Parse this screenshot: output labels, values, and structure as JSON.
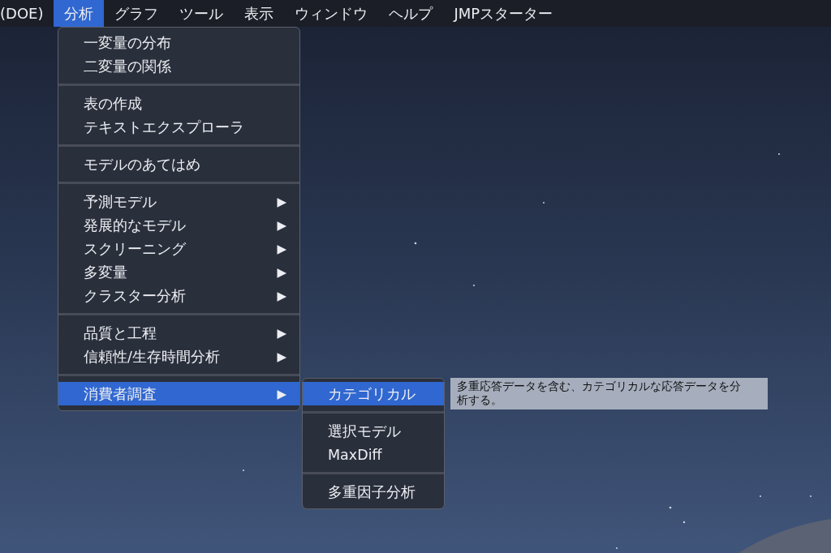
{
  "menu_bar": {
    "items": [
      {
        "label": "(DOE)",
        "selected": false
      },
      {
        "label": "分析",
        "selected": true
      },
      {
        "label": "グラフ",
        "selected": false
      },
      {
        "label": "ツール",
        "selected": false
      },
      {
        "label": "表示",
        "selected": false
      },
      {
        "label": "ウィンドウ",
        "selected": false
      },
      {
        "label": "ヘルプ",
        "selected": false
      },
      {
        "label": "JMPスターター",
        "selected": false
      }
    ]
  },
  "analysis_menu": {
    "groups": [
      [
        {
          "label": "一変量の分布",
          "selected": false
        },
        {
          "label": "二変量の関係",
          "selected": false
        }
      ],
      [
        {
          "label": "表の作成",
          "selected": false
        },
        {
          "label": "テキストエクスプローラ",
          "selected": false
        }
      ],
      [
        {
          "label": "モデルのあてはめ",
          "selected": false
        }
      ],
      [
        {
          "label": "予測モデル",
          "arrow": "▶",
          "selected": false
        },
        {
          "label": "発展的なモデル",
          "arrow": "▶",
          "selected": false
        },
        {
          "label": "スクリーニング",
          "arrow": "▶",
          "selected": false
        },
        {
          "label": "多変量",
          "arrow": "▶",
          "selected": false
        },
        {
          "label": "クラスター分析",
          "arrow": "▶",
          "selected": false
        }
      ],
      [
        {
          "label": "品質と工程",
          "arrow": "▶",
          "selected": false
        },
        {
          "label": "信頼性/生存時間分析",
          "arrow": "▶",
          "selected": false
        }
      ],
      [
        {
          "label": "消費者調査",
          "arrow": "▶",
          "selected": true
        }
      ]
    ]
  },
  "consumer_research_submenu": {
    "groups": [
      [
        {
          "label": "カテゴリカル",
          "selected": true
        }
      ],
      [
        {
          "label": "選択モデル",
          "selected": false
        },
        {
          "label": "MaxDiff",
          "selected": false
        }
      ],
      [
        {
          "label": "多重因子分析",
          "selected": false
        }
      ]
    ]
  },
  "tooltip": {
    "text": "多重応答データを含む、カテゴリカルな応答データを分析する。"
  }
}
